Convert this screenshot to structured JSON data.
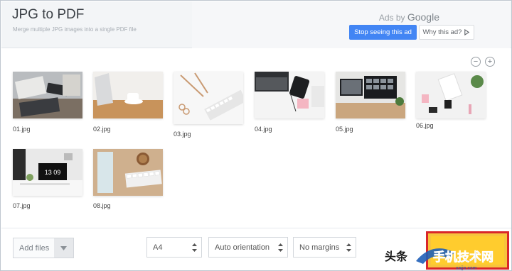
{
  "header": {
    "title": "JPG to PDF",
    "subtitle": "Merge multiple JPG images into a single PDF file",
    "back_icon": "←"
  },
  "ad": {
    "ads_by": "Ads by",
    "brand": "Google",
    "stop_label": "Stop seeing this ad",
    "why_label": "Why this ad?",
    "accent": "#4285f4"
  },
  "zoom": {
    "out": "−",
    "in": "+"
  },
  "images": [
    {
      "label": "01.jpg"
    },
    {
      "label": "02.jpg"
    },
    {
      "label": "03.jpg"
    },
    {
      "label": "04.jpg"
    },
    {
      "label": "05.jpg"
    },
    {
      "label": "06.jpg"
    },
    {
      "label": "07.jpg"
    },
    {
      "label": "08.jpg"
    }
  ],
  "toolbar": {
    "add_files": "Add files",
    "page_size": "A4",
    "orientation": "Auto orientation",
    "margins": "No margins"
  },
  "watermark": {
    "text": "头条",
    "logo_text": "手机技术网",
    "url": "xajjn.com"
  }
}
